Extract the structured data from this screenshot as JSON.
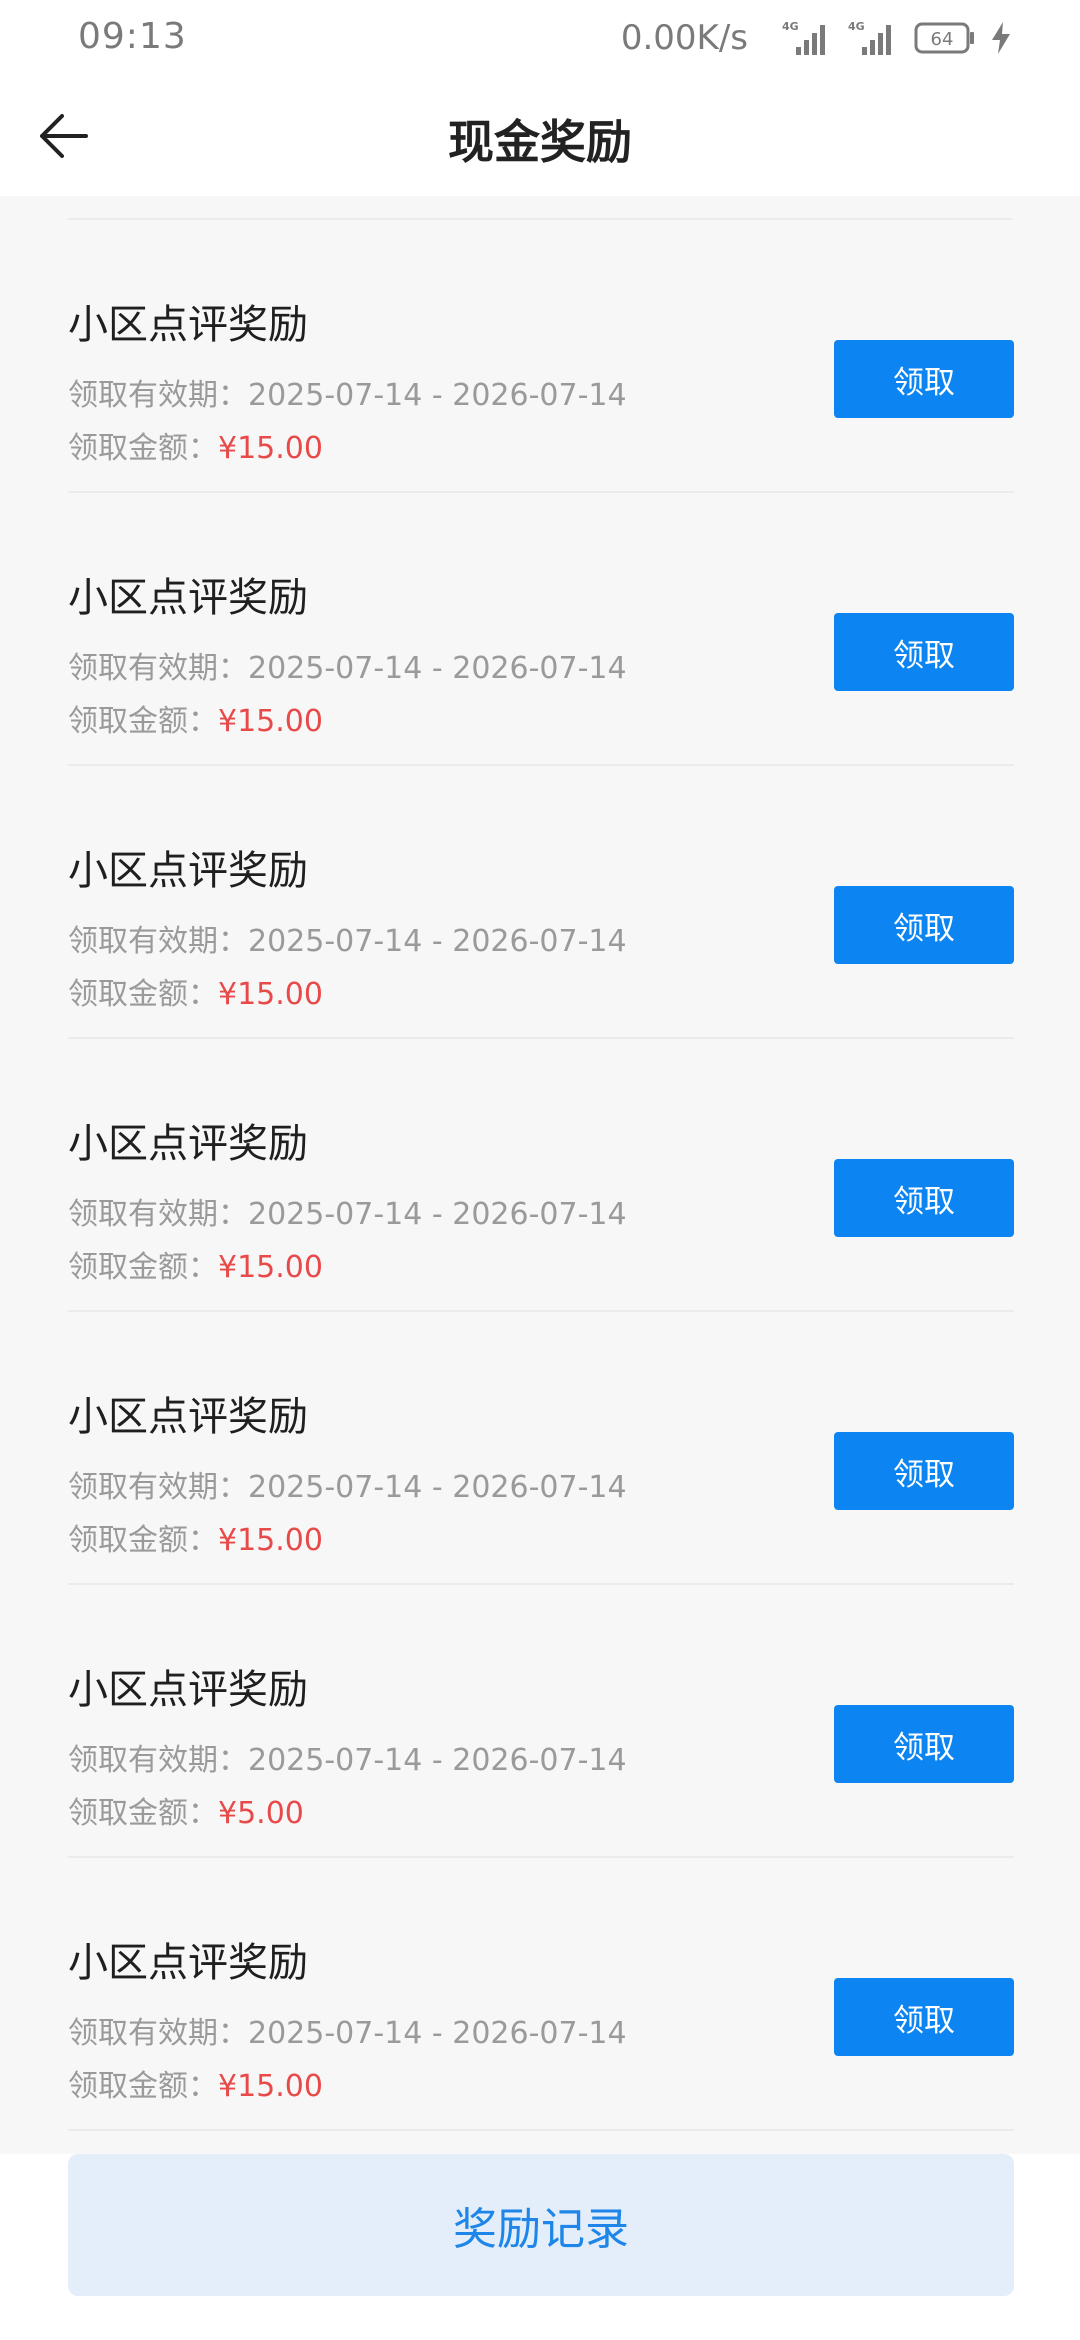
{
  "status_bar": {
    "time": "09:13",
    "net_speed": "0.00K/s",
    "signal1_label": "4G",
    "signal2_label": "4G",
    "battery_level": "64"
  },
  "header": {
    "title": "现金奖励"
  },
  "rewards": [
    {
      "title": "小区点评奖励",
      "period": "领取有效期：2025-07-14 - 2026-07-14",
      "amount_label": "领取金额：",
      "amount": "¥15.00",
      "button": "领取"
    },
    {
      "title": "小区点评奖励",
      "period": "领取有效期：2025-07-14 - 2026-07-14",
      "amount_label": "领取金额：",
      "amount": "¥15.00",
      "button": "领取"
    },
    {
      "title": "小区点评奖励",
      "period": "领取有效期：2025-07-14 - 2026-07-14",
      "amount_label": "领取金额：",
      "amount": "¥15.00",
      "button": "领取"
    },
    {
      "title": "小区点评奖励",
      "period": "领取有效期：2025-07-14 - 2026-07-14",
      "amount_label": "领取金额：",
      "amount": "¥15.00",
      "button": "领取"
    },
    {
      "title": "小区点评奖励",
      "period": "领取有效期：2025-07-14 - 2026-07-14",
      "amount_label": "领取金额：",
      "amount": "¥15.00",
      "button": "领取"
    },
    {
      "title": "小区点评奖励",
      "period": "领取有效期：2025-07-14 - 2026-07-14",
      "amount_label": "领取金额：",
      "amount": "¥5.00",
      "button": "领取"
    },
    {
      "title": "小区点评奖励",
      "period": "领取有效期：2025-07-14 - 2026-07-14",
      "amount_label": "领取金额：",
      "amount": "¥15.00",
      "button": "领取"
    }
  ],
  "footer": {
    "records_label": "奖励记录"
  },
  "colors": {
    "primary_blue": "#0c84f2",
    "amount_red": "#e84a4a",
    "records_bg": "#e3eefa",
    "records_text": "#1e86e8"
  }
}
